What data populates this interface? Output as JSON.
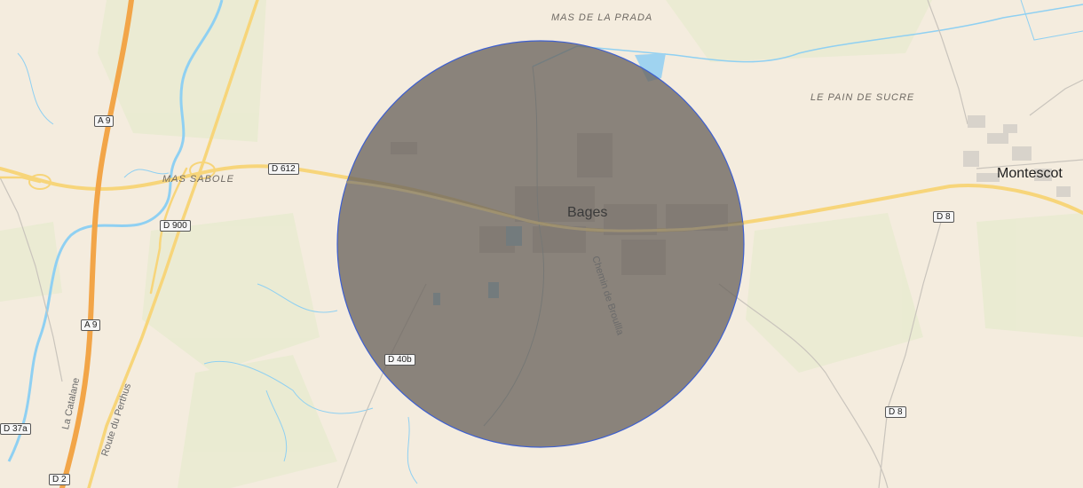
{
  "map": {
    "places": {
      "mas_de_la_prada": "MAS DE LA PRADA",
      "le_pain_de_sucre": "LE PAIN DE SUCRE",
      "mas_sabole": "MAS SABOLE",
      "bages": "Bages",
      "montescot": "Montescot"
    },
    "streets": {
      "chemin_de_broullla": "Chemin de Broullla",
      "la_catalane": "La Catalane",
      "route_du_perthus": "Route du Perthus"
    },
    "road_shields": {
      "a9_top": "A 9",
      "a9_bottom": "A 9",
      "d612": "D 612",
      "d900": "D 900",
      "d8_upper": "D 8",
      "d8_lower": "D 8",
      "d40b": "D 40b",
      "d37a": "D 37a",
      "d2": "D 2"
    },
    "overlay": {
      "type": "circle",
      "fill_color": "#6b655f",
      "stroke_color": "#3d5fd0"
    },
    "colors": {
      "land": "#f4ecde",
      "motorway": "#f2a548",
      "primary_road": "#f7d57a",
      "water": "#8fd0f2",
      "vegetation": "#e8ecd2"
    }
  }
}
